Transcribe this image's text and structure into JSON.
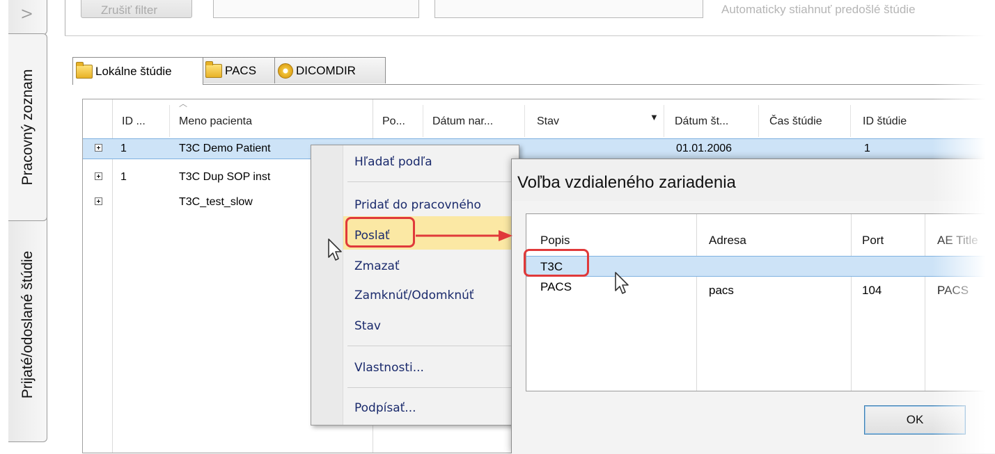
{
  "sidebar": {
    "tabs": [
      {
        "label": "V"
      },
      {
        "label": "Pracovný zoznam"
      },
      {
        "label": "Prijaté/odoslané štúdie"
      }
    ]
  },
  "toolbar": {
    "clear_filter_label": "Zrušiť filter",
    "auto_download_label": "Automaticky stiahnuť predošlé štúdie"
  },
  "study_tabs": [
    {
      "label": "Lokálne štúdie",
      "icon": "folder-icon",
      "active": true
    },
    {
      "label": "PACS",
      "icon": "network-folder-icon",
      "active": false
    },
    {
      "label": "DICOMDIR",
      "icon": "disc-icon",
      "active": false
    }
  ],
  "grid": {
    "columns": [
      "ID ...",
      "Meno pacienta",
      "Po...",
      "Dátum nar...",
      "Stav",
      "Dátum št...",
      "Čas štúdie",
      "ID štúdie"
    ],
    "rows": [
      {
        "id": "1",
        "name": "T3C Demo Patient",
        "study_date": "01.01.2006",
        "study_id": "1",
        "selected": true
      },
      {
        "id": "1",
        "name": "T3C Dup SOP inst",
        "study_date": "",
        "study_id": "",
        "selected": false
      },
      {
        "id": "",
        "name": "T3C_test_slow",
        "study_date": "",
        "study_id": "",
        "selected": false
      }
    ]
  },
  "context_menu": {
    "items": [
      {
        "label": "Hľadať podľa"
      },
      {
        "label": "Pridať do pracovného"
      },
      {
        "label": "Poslať",
        "highlighted": true
      },
      {
        "label": "Zmazať"
      },
      {
        "label": "Zamknúť/Odomknúť"
      },
      {
        "label": "Stav"
      },
      {
        "label": "Vlastnosti..."
      },
      {
        "label": "Podpísať..."
      }
    ]
  },
  "dialog": {
    "title": "Voľba vzdialeného zariadenia",
    "columns": [
      "Popis",
      "Adresa",
      "Port",
      "AE Title"
    ],
    "rows": [
      {
        "popis": "T3C",
        "adresa": "",
        "port": "",
        "ae": "",
        "selected": true
      },
      {
        "popis": "PACS",
        "adresa": "pacs",
        "port": "104",
        "ae": "PACS",
        "selected": false
      }
    ],
    "ok_label": "OK"
  },
  "colors": {
    "selection": "#cde3f7",
    "menu_highlight": "#fbe8a4",
    "annotation": "#e0393a"
  }
}
